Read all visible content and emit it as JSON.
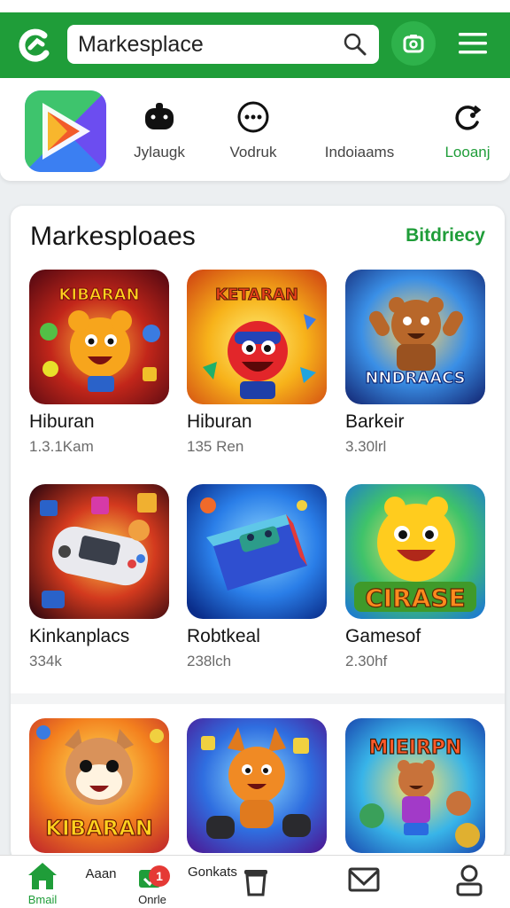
{
  "search": {
    "value": "Markesplace"
  },
  "categories": [
    {
      "label": "Jylaugk",
      "icon": "gamepad-icon"
    },
    {
      "label": "Vodruk",
      "icon": "more-icon"
    },
    {
      "label": "Indoiaams",
      "icon": "apps-icon"
    },
    {
      "label": "Looanj",
      "icon": "refresh-icon"
    }
  ],
  "section": {
    "title": "Markesploaes",
    "link": "Bitdriecy"
  },
  "apps": [
    {
      "art_text": "KIBARAN",
      "name": "Hiburan",
      "meta": "1.3.1Kam"
    },
    {
      "art_text": "KETARAN",
      "name": "Hiburan",
      "meta": "135 Ren"
    },
    {
      "art_text": "NNDRAACS",
      "name": "Barkeir",
      "meta": "3.30lrl"
    },
    {
      "art_text": "",
      "name": "Kinkanplacs",
      "meta": "334k"
    },
    {
      "art_text": "",
      "name": "Robtkeal",
      "meta": "238lch"
    },
    {
      "art_text": "CIRASE",
      "name": "Gamesof",
      "meta": "2.30hf"
    },
    {
      "art_text": "KIBARAN",
      "name": "",
      "meta": ""
    },
    {
      "art_text": "",
      "name": "",
      "meta": ""
    },
    {
      "art_text": "MIEIRPN",
      "name": "",
      "meta": ""
    }
  ],
  "bottom_nav": [
    {
      "label": "Bmail",
      "icon": "home-icon"
    },
    {
      "label": "Aaan",
      "icon": ""
    },
    {
      "label": "Onrle",
      "icon": "game-icon"
    },
    {
      "label": "Gonkats",
      "icon": "bin-icon"
    },
    {
      "label": "",
      "icon": "mail-icon"
    },
    {
      "label": "",
      "icon": "profile-icon"
    }
  ],
  "badge": "1",
  "colors": {
    "primary": "#1f9d39",
    "badge": "#e53935"
  }
}
